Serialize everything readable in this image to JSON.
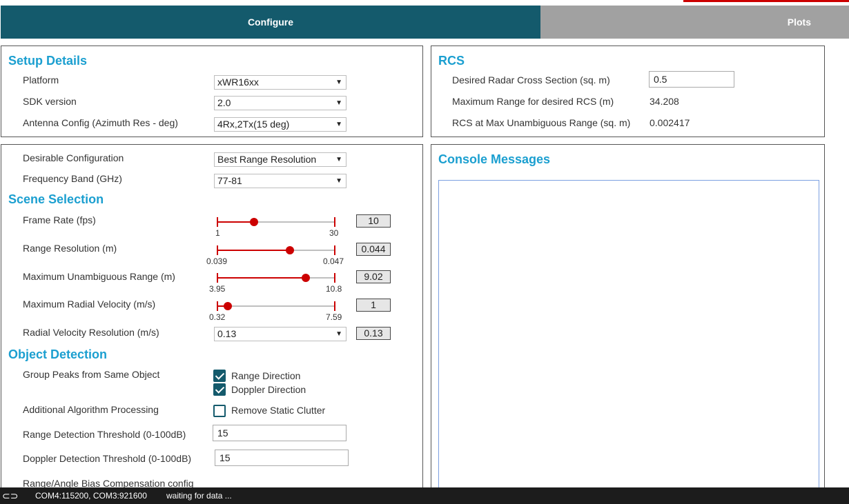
{
  "tabs": {
    "configure": "Configure",
    "plots": "Plots"
  },
  "setup": {
    "title": "Setup Details",
    "platform": {
      "label": "Platform",
      "value": "xWR16xx"
    },
    "sdk": {
      "label": "SDK version",
      "value": "2.0"
    },
    "antenna": {
      "label": "Antenna Config (Azimuth Res - deg)",
      "value": "4Rx,2Tx(15 deg)"
    }
  },
  "rcs": {
    "title": "RCS",
    "desired": {
      "label": "Desired Radar Cross Section (sq. m)",
      "value": "0.5"
    },
    "max_range": {
      "label": "Maximum Range for desired RCS (m)",
      "value": "34.208"
    },
    "rcs_max": {
      "label": "RCS at Max Unambiguous Range (sq. m)",
      "value": "0.002417"
    }
  },
  "config": {
    "desirable": {
      "label": "Desirable Configuration",
      "value": "Best Range Resolution"
    },
    "band": {
      "label": "Frequency Band (GHz)",
      "value": "77-81"
    }
  },
  "scene": {
    "title": "Scene Selection",
    "frame_rate": {
      "label": "Frame Rate (fps)",
      "min": "1",
      "max": "30",
      "value": "10",
      "fraction": 0.31
    },
    "range_res": {
      "label": "Range Resolution (m)",
      "min": "0.039",
      "max": "0.047",
      "value": "0.044",
      "fraction": 0.62
    },
    "max_range": {
      "label": "Maximum Unambiguous Range (m)",
      "min": "3.95",
      "max": "10.8",
      "value": "9.02",
      "fraction": 0.75
    },
    "max_vel": {
      "label": "Maximum Radial Velocity (m/s)",
      "min": "0.32",
      "max": "7.59",
      "value": "1",
      "fraction": 0.09
    },
    "vel_res": {
      "label": "Radial Velocity Resolution (m/s)",
      "select_value": "0.13",
      "value": "0.13"
    }
  },
  "detection": {
    "title": "Object Detection",
    "group_peaks": {
      "label": "Group Peaks from Same Object",
      "range": "Range Direction",
      "doppler": "Doppler Direction"
    },
    "additional": {
      "label": "Additional Algorithm Processing",
      "static": "Remove Static Clutter"
    },
    "range_threshold": {
      "label": "Range Detection Threshold (0-100dB)",
      "value": "15"
    },
    "doppler_threshold": {
      "label": "Doppler Detection Threshold (0-100dB)",
      "value": "15"
    },
    "bias": {
      "label": "Range/Angle Bias Compensation config"
    }
  },
  "console": {
    "title": "Console Messages"
  },
  "status": {
    "ports": "COM4:115200, COM3:921600",
    "message": "waiting for data ..."
  }
}
